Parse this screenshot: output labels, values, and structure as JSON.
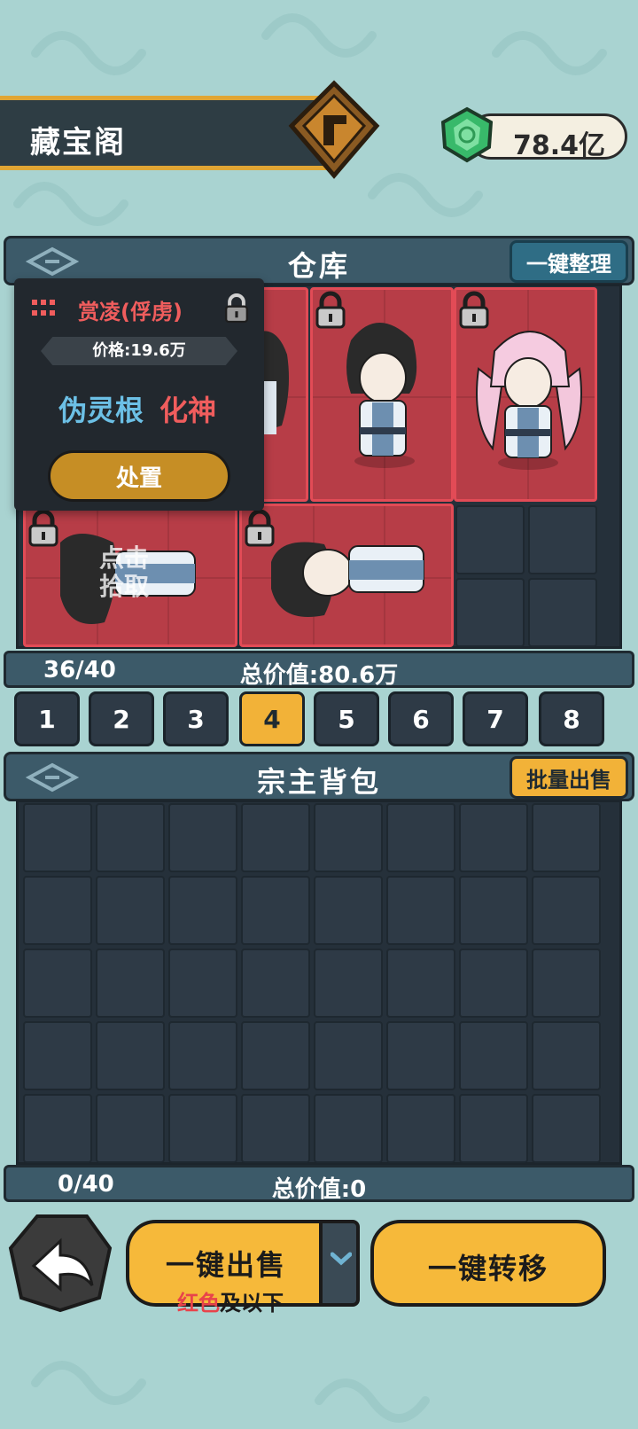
{
  "header": {
    "title": "藏宝阁",
    "currency_amount": "78.4亿"
  },
  "warehouse": {
    "title": "仓库",
    "organize_button": "一键整理",
    "count": "36/40",
    "total_value": "总价值:80.6万",
    "pick_hint_line1": "点击",
    "pick_hint_line2": "拾取"
  },
  "tooltip": {
    "name": "赏凌(俘虏)",
    "price": "价格:19.6万",
    "spirit_root": "伪灵根",
    "realm": "化神",
    "action_button": "处置"
  },
  "page_tabs": {
    "items": [
      "1",
      "2",
      "3",
      "4",
      "5",
      "6",
      "7",
      "8"
    ],
    "selected": "4"
  },
  "backpack": {
    "title": "宗主背包",
    "bulk_sell_button": "批量出售",
    "count": "0/40",
    "total_value": "总价值:0"
  },
  "bottom_bar": {
    "sell_all_button": "一键出售",
    "sell_filter_highlight": "红色",
    "sell_filter_rest": "及以下",
    "transfer_all_button": "一键转移"
  },
  "colors": {
    "background": "#a9d3d1",
    "panel": "#3c5a69",
    "accent_gold": "#f2b238",
    "rarity_red": "#b73d47",
    "highlight_red": "#f05d5d",
    "spirit_blue": "#6cc0e6"
  }
}
